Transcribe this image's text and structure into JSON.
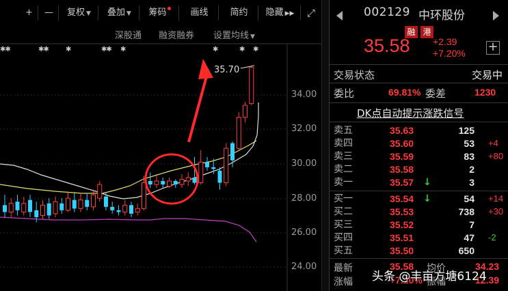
{
  "toolbar": {
    "zoom_in": "+",
    "zoom_out": "—",
    "fuquan": "复权",
    "diejia": "叠加",
    "chouma": "筹码",
    "huaxian": "画线",
    "jianyue": "简约",
    "yincang": "隐藏",
    "expand": "⤢"
  },
  "subtoolbar": {
    "shengutong": "深股通",
    "rongzi": "融资融券",
    "setma": "设置均线"
  },
  "chart_data": {
    "type": "candlestick",
    "y_ticks": [
      "34.00",
      "32.00",
      "30.00",
      "28.00",
      "26.00",
      "24.00"
    ],
    "ylim": [
      23.3,
      36.3
    ],
    "high_label": "35.70",
    "candles": [
      {
        "o": 27.6,
        "c": 27.2,
        "h": 28.2,
        "l": 26.9
      },
      {
        "o": 27.2,
        "c": 27.7,
        "h": 28.0,
        "l": 26.9
      },
      {
        "o": 27.8,
        "c": 27.3,
        "h": 28.2,
        "l": 27.0
      },
      {
        "o": 27.2,
        "c": 27.7,
        "h": 28.1,
        "l": 27.0
      },
      {
        "o": 27.9,
        "c": 27.2,
        "h": 28.2,
        "l": 26.9
      },
      {
        "o": 27.3,
        "c": 26.9,
        "h": 27.8,
        "l": 26.6
      },
      {
        "o": 27.0,
        "c": 27.6,
        "h": 27.9,
        "l": 26.8
      },
      {
        "o": 27.7,
        "c": 27.0,
        "h": 28.0,
        "l": 26.8
      },
      {
        "o": 27.1,
        "c": 27.8,
        "h": 28.1,
        "l": 26.9
      },
      {
        "o": 27.7,
        "c": 27.3,
        "h": 28.0,
        "l": 27.1
      },
      {
        "o": 27.3,
        "c": 28.0,
        "h": 28.4,
        "l": 27.2
      },
      {
        "o": 27.9,
        "c": 27.4,
        "h": 28.3,
        "l": 27.2
      },
      {
        "o": 27.4,
        "c": 27.9,
        "h": 28.3,
        "l": 27.2
      },
      {
        "o": 27.9,
        "c": 27.5,
        "h": 28.3,
        "l": 27.3
      },
      {
        "o": 27.5,
        "c": 28.2,
        "h": 28.5,
        "l": 27.3
      },
      {
        "o": 28.0,
        "c": 28.8,
        "h": 29.0,
        "l": 27.8
      },
      {
        "o": 28.1,
        "c": 27.5,
        "h": 28.3,
        "l": 27.3
      },
      {
        "o": 27.5,
        "c": 27.3,
        "h": 27.8,
        "l": 27.1
      },
      {
        "o": 27.3,
        "c": 27.2,
        "h": 27.6,
        "l": 27.0
      },
      {
        "o": 27.2,
        "c": 27.6,
        "h": 27.9,
        "l": 27.0
      },
      {
        "o": 27.6,
        "c": 27.1,
        "h": 27.8,
        "l": 26.9
      },
      {
        "o": 27.2,
        "c": 27.4,
        "h": 27.7,
        "l": 27.0
      },
      {
        "o": 27.4,
        "c": 28.9,
        "h": 29.3,
        "l": 27.3
      },
      {
        "o": 29.0,
        "c": 28.8,
        "h": 29.5,
        "l": 28.6
      },
      {
        "o": 28.8,
        "c": 29.0,
        "h": 29.3,
        "l": 28.6
      },
      {
        "o": 29.0,
        "c": 28.8,
        "h": 29.2,
        "l": 28.6
      },
      {
        "o": 28.7,
        "c": 29.0,
        "h": 29.2,
        "l": 28.6
      },
      {
        "o": 29.0,
        "c": 28.8,
        "h": 29.1,
        "l": 28.6
      },
      {
        "o": 28.8,
        "c": 29.1,
        "h": 29.4,
        "l": 28.6
      },
      {
        "o": 29.0,
        "c": 29.2,
        "h": 29.5,
        "l": 28.7
      },
      {
        "o": 29.2,
        "c": 28.9,
        "h": 30.4,
        "l": 28.8
      },
      {
        "o": 28.9,
        "c": 30.1,
        "h": 30.8,
        "l": 28.8
      },
      {
        "o": 30.1,
        "c": 29.8,
        "h": 30.4,
        "l": 29.6
      },
      {
        "o": 29.8,
        "c": 29.7,
        "h": 30.3,
        "l": 29.4
      },
      {
        "o": 29.6,
        "c": 28.9,
        "h": 29.8,
        "l": 28.5
      },
      {
        "o": 28.9,
        "c": 30.9,
        "h": 31.2,
        "l": 28.7
      },
      {
        "o": 31.2,
        "c": 30.2,
        "h": 31.3,
        "l": 29.8
      },
      {
        "o": 30.9,
        "c": 32.7,
        "h": 33.0,
        "l": 30.8
      },
      {
        "o": 32.7,
        "c": 33.4,
        "h": 33.6,
        "l": 32.4
      },
      {
        "o": 33.5,
        "c": 35.6,
        "h": 35.7,
        "l": 33.4
      }
    ]
  },
  "quote": {
    "code": "002129",
    "name": "中环股份",
    "tag_rong": "融",
    "tag_gang": "港",
    "last_price": "35.58",
    "change_abs": "+2.39",
    "change_pct": "+7.20%",
    "add": "+",
    "status_label": "交易状态",
    "status_value": "交易中",
    "webi_label": "委比",
    "webi_value": "69.81%",
    "weicha_label": "委差",
    "weicha_value": "1230",
    "signal_link": "DK点自动提示涨跌信号",
    "asks": [
      {
        "label": "卖五",
        "price": "35.63",
        "vol": "125",
        "chg": ""
      },
      {
        "label": "卖四",
        "price": "35.60",
        "vol": "53",
        "chg": "+4"
      },
      {
        "label": "卖三",
        "price": "35.59",
        "vol": "83",
        "chg": "+80"
      },
      {
        "label": "卖二",
        "price": "35.58",
        "vol": "2",
        "chg": ""
      },
      {
        "label": "卖一",
        "price": "35.57",
        "vol": "3",
        "chg": ""
      }
    ],
    "bids": [
      {
        "label": "买一",
        "price": "35.54",
        "vol": "54",
        "chg": "+14"
      },
      {
        "label": "买二",
        "price": "35.53",
        "vol": "738",
        "chg": "+30"
      },
      {
        "label": "买三",
        "price": "35.52",
        "vol": "7",
        "chg": ""
      },
      {
        "label": "买四",
        "price": "35.51",
        "vol": "47",
        "chg": "-2"
      },
      {
        "label": "买五",
        "price": "35.50",
        "vol": "650",
        "chg": ""
      }
    ],
    "latest_label": "最新",
    "latest_value": "35.58",
    "avg_label": "均价",
    "avg_value": "34.23",
    "pct_label": "涨幅",
    "pct_value": "+7.20%",
    "amp_label": "振幅",
    "amp_value": "12.39"
  },
  "watermark": "头条 @丰亩方塘6124",
  "colors": {
    "up": "#ff3b3b",
    "down": "#2ecc40",
    "candle_up": "#ff4040",
    "candle_down": "#35d0ff",
    "ma_yellow": "#e8e06a",
    "ma_white": "#e0e0e0",
    "ma_purple": "#c040c0",
    "annotation": "#ff2a2a",
    "tag_bg": "#b01818"
  }
}
